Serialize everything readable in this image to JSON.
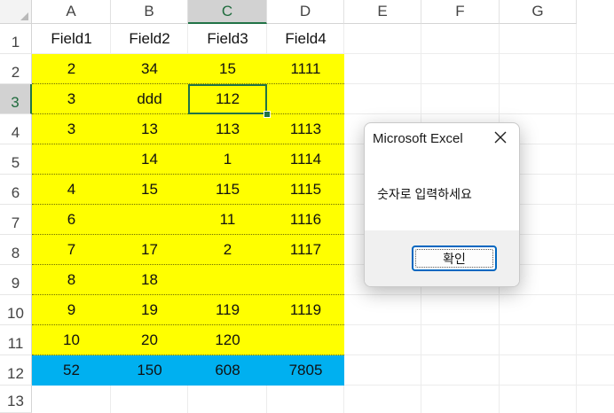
{
  "columns": [
    "A",
    "B",
    "C",
    "D",
    "E",
    "F",
    "G"
  ],
  "rows": [
    "1",
    "2",
    "3",
    "4",
    "5",
    "6",
    "7",
    "8",
    "9",
    "10",
    "11",
    "12",
    "13"
  ],
  "header_row": [
    "Field1",
    "Field2",
    "Field3",
    "Field4"
  ],
  "data_rows": [
    [
      "2",
      "34",
      "15",
      "1111"
    ],
    [
      "3",
      "ddd",
      "112",
      ""
    ],
    [
      "3",
      "13",
      "113",
      "1113"
    ],
    [
      "",
      "14",
      "1",
      "1114"
    ],
    [
      "4",
      "15",
      "115",
      "1115"
    ],
    [
      "6",
      "",
      "11",
      "1116"
    ],
    [
      "7",
      "17",
      "2",
      "1117"
    ],
    [
      "8",
      "18",
      "",
      ""
    ],
    [
      "9",
      "19",
      "119",
      "1119"
    ],
    [
      "10",
      "20",
      "120",
      ""
    ]
  ],
  "total_row": [
    "52",
    "150",
    "608",
    "7805"
  ],
  "colors": {
    "data_fill": "#ffff00",
    "total_fill": "#00b0f0",
    "selection": "#217346"
  },
  "dialog": {
    "title": "Microsoft Excel",
    "message": "숫자로 입력하세요",
    "ok_label": "확인",
    "close_icon": "close-icon"
  }
}
